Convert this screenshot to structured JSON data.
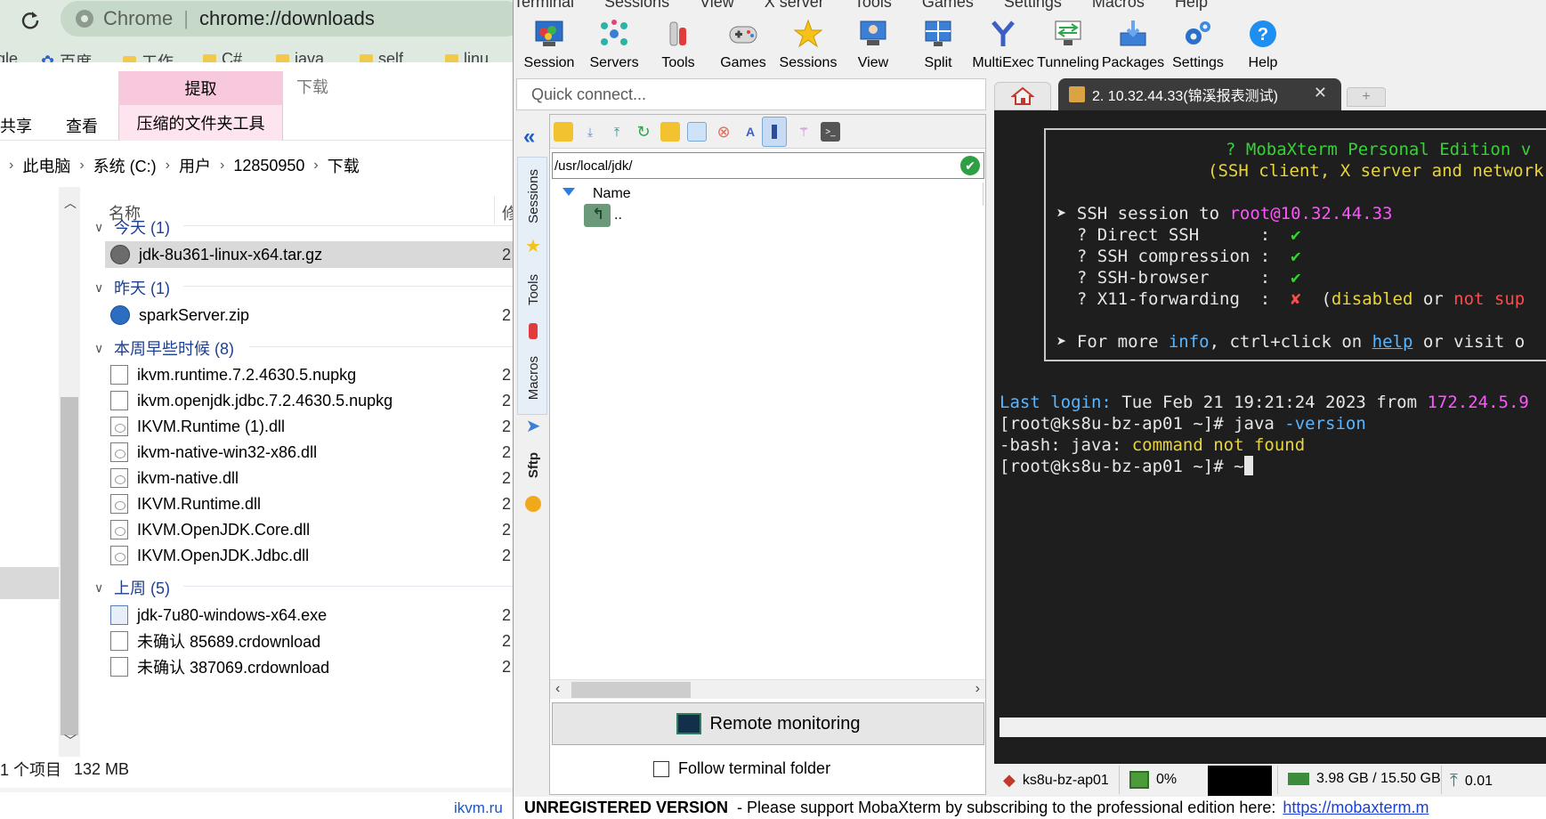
{
  "chrome": {
    "address_brand": "Chrome",
    "address_url": "chrome://downloads",
    "bookmarks": [
      "gle",
      "百度",
      "工作",
      "C#",
      "java",
      "self",
      "linu"
    ]
  },
  "explorer": {
    "ribbon_extract": "提取",
    "ribbon_download": "下载",
    "ribbon_share": "共享",
    "ribbon_view": "查看",
    "ribbon_zip_tools": "压缩的文件夹工具",
    "breadcrumb": [
      "此电脑",
      "系统 (C:)",
      "用户",
      "12850950",
      "下载"
    ],
    "col_name": "名称",
    "col_modified": "修",
    "groups": [
      {
        "label": "今天 (1)",
        "files": [
          {
            "name": "jdk-8u361-linux-x64.tar.gz",
            "type": "gz",
            "selected": true
          }
        ]
      },
      {
        "label": "昨天 (1)",
        "files": [
          {
            "name": "sparkServer.zip",
            "type": "zip"
          }
        ]
      },
      {
        "label": "本周早些时候 (8)",
        "files": [
          {
            "name": "ikvm.runtime.7.2.4630.5.nupkg",
            "type": "doc"
          },
          {
            "name": "ikvm.openjdk.jdbc.7.2.4630.5.nupkg",
            "type": "doc"
          },
          {
            "name": "IKVM.Runtime (1).dll",
            "type": "dll"
          },
          {
            "name": "ikvm-native-win32-x86.dll",
            "type": "dll"
          },
          {
            "name": "ikvm-native.dll",
            "type": "dll"
          },
          {
            "name": "IKVM.Runtime.dll",
            "type": "dll"
          },
          {
            "name": "IKVM.OpenJDK.Core.dll",
            "type": "dll"
          },
          {
            "name": "IKVM.OpenJDK.Jdbc.dll",
            "type": "dll"
          }
        ]
      },
      {
        "label": "上周 (5)",
        "files": [
          {
            "name": "jdk-7u80-windows-x64.exe",
            "type": "exe"
          },
          {
            "name": "未确认 85689.crdownload",
            "type": "doc"
          },
          {
            "name": "未确认 387069.crdownload",
            "type": "doc"
          }
        ]
      }
    ],
    "date_peek": "2",
    "status_count": "1 个项目",
    "status_size": "132 MB",
    "behind_text": "ikvm.ru"
  },
  "moba": {
    "menu": [
      "Terminal",
      "Sessions",
      "View",
      "X server",
      "Tools",
      "Games",
      "Settings",
      "Macros",
      "Help"
    ],
    "toolbar": [
      "Session",
      "Servers",
      "Tools",
      "Games",
      "Sessions",
      "View",
      "Split",
      "MultiExec",
      "Tunneling",
      "Packages",
      "Settings",
      "Help"
    ],
    "quick_connect_placeholder": "Quick connect...",
    "side_tabs": [
      "Sessions",
      "Tools",
      "Macros",
      "Sftp"
    ],
    "sftp_path": "/usr/local/jdk/",
    "sftp_col_name": "Name",
    "sftp_up": "..",
    "remote_monitoring": "Remote monitoring",
    "follow_terminal": "Follow terminal folder",
    "session_tab_label": "2.  10.32.44.33(锦溪报表测试)",
    "status": {
      "host": "ks8u-bz-ap01",
      "cpu": "0%",
      "memory": "3.98 GB / 15.50 GB",
      "upload": "0.01"
    },
    "unregistered_label": "UNREGISTERED VERSION",
    "unregistered_msg": "-  Please support MobaXterm by subscribing to the professional edition here:",
    "unregistered_link": "https://mobaxterm.m"
  },
  "terminal": {
    "banner_title": "? MobaXterm Personal Edition v",
    "banner_sub": "(SSH client, X server and network",
    "ssh_prefix": "➤ SSH session to ",
    "ssh_target": "root@10.32.44.33",
    "checks": [
      {
        "label": "  ? Direct SSH      :  ",
        "mark": "✔"
      },
      {
        "label": "  ? SSH compression :  ",
        "mark": "✔"
      },
      {
        "label": "  ? SSH-browser     :  ",
        "mark": "✔"
      }
    ],
    "x11_label": "  ? X11-forwarding  :  ",
    "x11_mark": "✘",
    "x11_paren": "  (",
    "x11_disabled": "disabled",
    "x11_or": " or ",
    "x11_notsup": "not sup",
    "more_prefix": "➤ For more ",
    "more_info": "info",
    "more_mid": ", ctrl+click on ",
    "more_help": "help",
    "more_end": " or visit o",
    "last_login_label": "Last login:",
    "last_login_value": " Tue Feb 21 19:21:24 2023 from ",
    "last_login_ip": "172.24.5.9",
    "prompt1": "[root@ks8u-bz-ap01 ~]# java ",
    "prompt1_arg": "-version",
    "bash_prefix": "-bash: java: ",
    "bash_err": "command not found",
    "prompt2": "[root@ks8u-bz-ap01 ~]# ~"
  },
  "colors": {
    "chrome_bg": "#dee9df",
    "ribbon_pink": "#f8c9dc",
    "terminal_bg": "#1e1e1e",
    "link_blue": "#1a3fd6"
  }
}
